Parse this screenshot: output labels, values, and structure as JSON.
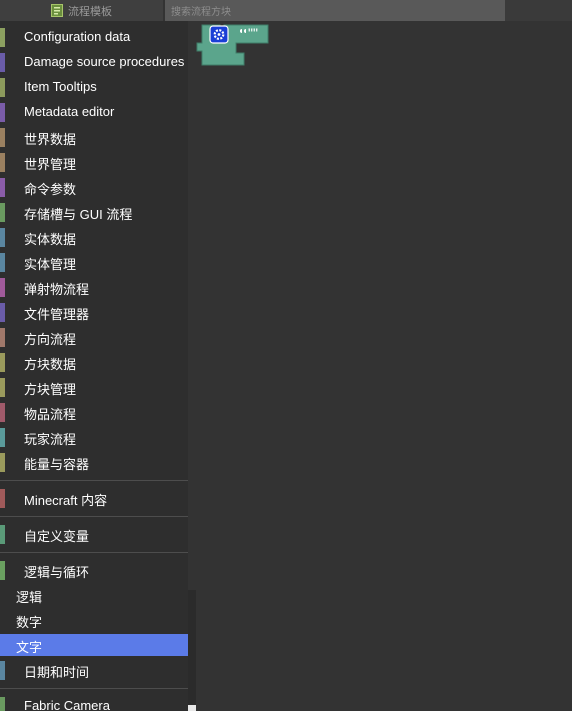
{
  "topbar": {
    "templates_tab_label": "流程模板",
    "search_placeholder": "搜索流程方块"
  },
  "sidebar": {
    "categories": [
      {
        "label": "Configuration data",
        "color": "#8ca060"
      },
      {
        "label": "Damage source procedures",
        "color": "#6a5ca8"
      },
      {
        "label": "Item Tooltips",
        "color": "#8c9a5c"
      },
      {
        "label": "Metadata editor",
        "color": "#7a5ca8"
      },
      {
        "label": "世界数据",
        "color": "#9a8060"
      },
      {
        "label": "世界管理",
        "color": "#9a8060"
      },
      {
        "label": "命令参数",
        "color": "#8a5ca8"
      },
      {
        "label": "存储槽与 GUI 流程",
        "color": "#6a9a60"
      },
      {
        "label": "实体数据",
        "color": "#5a86a0"
      },
      {
        "label": "实体管理",
        "color": "#5a86a0"
      },
      {
        "label": "弹射物流程",
        "color": "#a05a9a"
      },
      {
        "label": "文件管理器",
        "color": "#6a5ca8"
      },
      {
        "label": "方向流程",
        "color": "#a0786a"
      },
      {
        "label": "方块数据",
        "color": "#9a9a5c"
      },
      {
        "label": "方块管理",
        "color": "#9a9a5c"
      },
      {
        "label": "物品流程",
        "color": "#a05a6a"
      },
      {
        "label": "玩家流程",
        "color": "#5a9a9a"
      },
      {
        "label": "能量与容器",
        "color": "#9a9a5c"
      },
      {
        "label": "Minecraft 内容",
        "color": "#a05a5a"
      },
      {
        "label": "自定义变量",
        "color": "#5a9a78"
      },
      {
        "label": "逻辑与循环",
        "color": "#6aa060"
      },
      {
        "label": "逻辑",
        "color": ""
      },
      {
        "label": "数字",
        "color": ""
      },
      {
        "label": "文字",
        "color": ""
      },
      {
        "label": "日期和时间",
        "color": "#5a86a0"
      },
      {
        "label": "Fabric Camera",
        "color": "#6a9a60"
      }
    ]
  },
  "workspace": {
    "block": {
      "color": "#5ba58c",
      "gear_color": "#1a3fd6",
      "quote_text": "\"\"",
      "icon": "gear-icon"
    }
  }
}
